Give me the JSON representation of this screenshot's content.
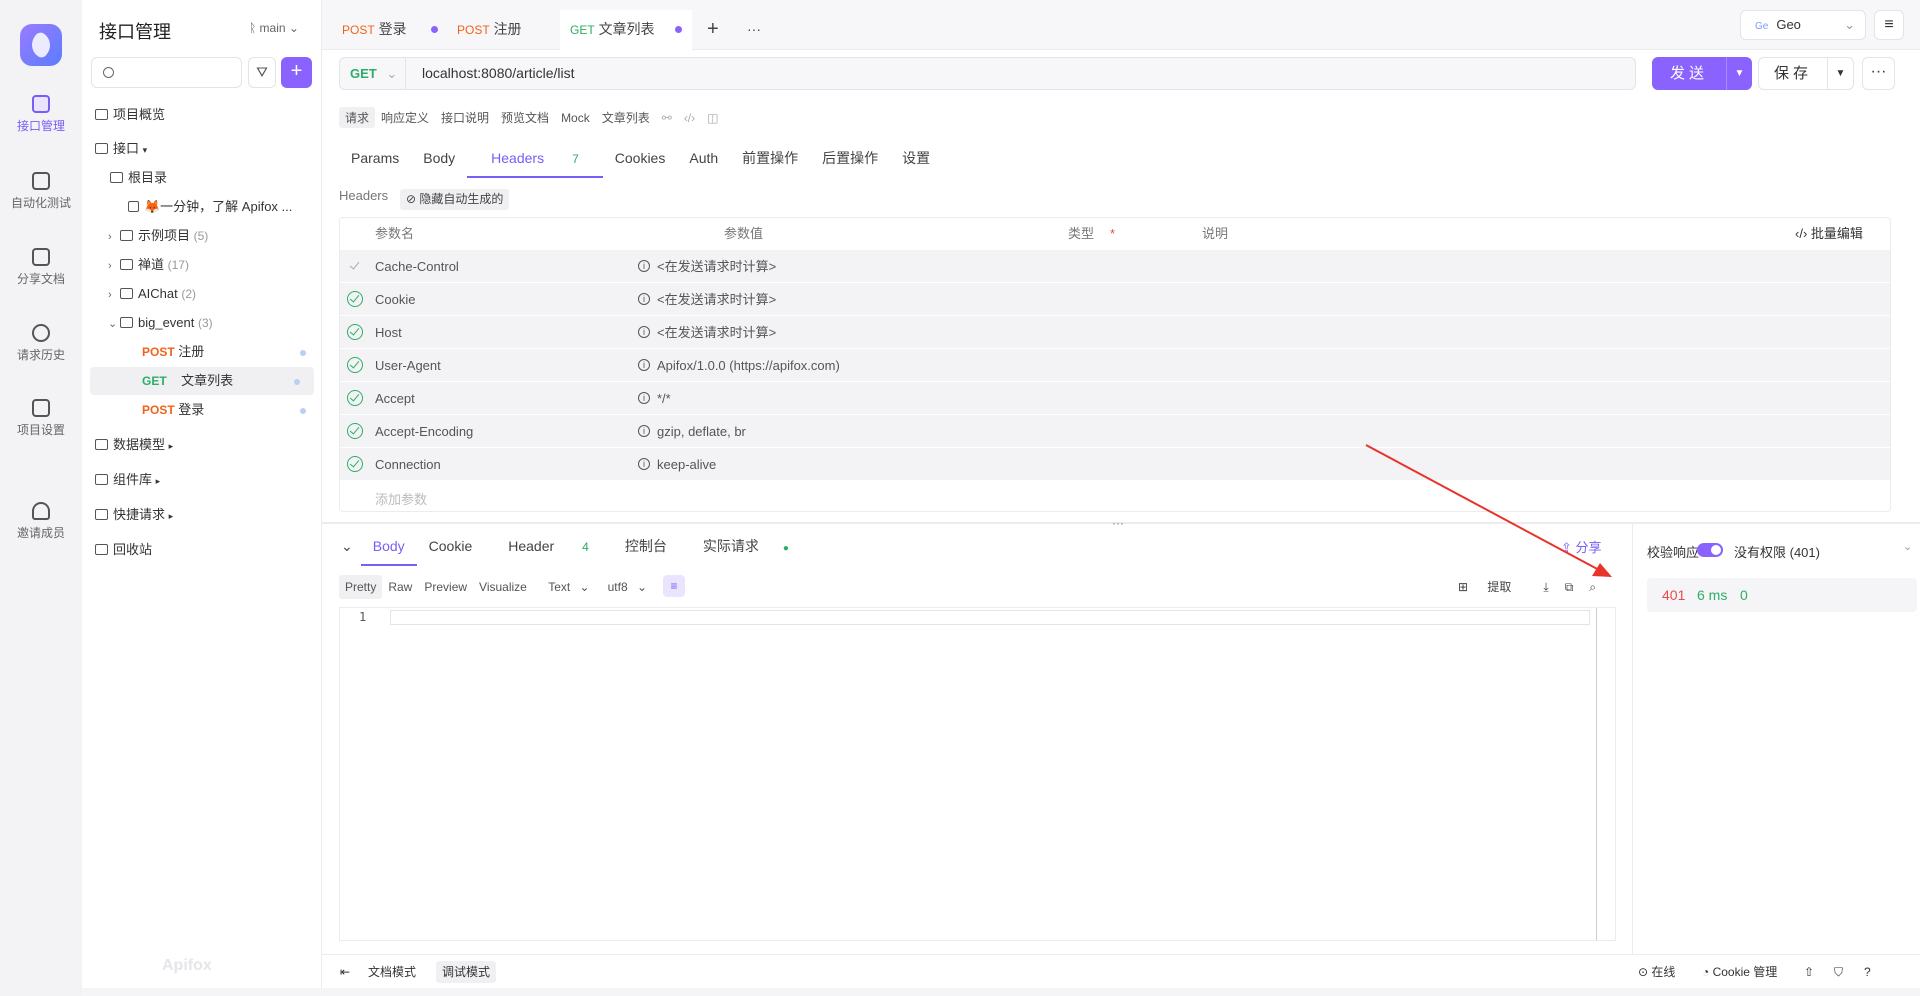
{
  "rail": {
    "items": [
      {
        "label": "接口管理",
        "icon": "api-icon"
      },
      {
        "label": "自动化测试",
        "icon": "automation-icon"
      },
      {
        "label": "分享文档",
        "icon": "share-doc-icon"
      },
      {
        "label": "请求历史",
        "icon": "history-icon"
      },
      {
        "label": "项目设置",
        "icon": "settings-icon"
      },
      {
        "label": "邀请成员",
        "icon": "invite-icon"
      }
    ]
  },
  "sidebar": {
    "title": "接口管理",
    "branch": "main",
    "search_placeholder": "",
    "tree": {
      "overview": "项目概览",
      "api_root": "接口",
      "root_dir": "根目录",
      "intro": "🦊一分钟，了解 Apifox ...",
      "example": {
        "label": "示例项目",
        "count": "(5)"
      },
      "zen": {
        "label": "禅道",
        "count": "(17)"
      },
      "aichat": {
        "label": "AIChat",
        "count": "(2)"
      },
      "big_event": {
        "label": "big_event",
        "count": "(3)"
      },
      "endpoints": [
        {
          "method": "POST",
          "name": "注册"
        },
        {
          "method": "GET",
          "name": "文章列表"
        },
        {
          "method": "POST",
          "name": "登录"
        }
      ],
      "data_model": "数据模型",
      "components": "组件库",
      "quick_request": "快捷请求",
      "recycle": "回收站"
    },
    "watermark": "Apifox"
  },
  "tabs": [
    {
      "method": "POST",
      "name": "登录"
    },
    {
      "method": "POST",
      "name": "注册"
    },
    {
      "method": "GET",
      "name": "文章列表"
    }
  ],
  "env": {
    "badge": "Ge",
    "name": "Geo"
  },
  "request": {
    "method": "GET",
    "url": "localhost:8080/article/list",
    "send": "发送",
    "save": "保存"
  },
  "subtabs": [
    "请求",
    "响应定义",
    "接口说明",
    "预览文档",
    "Mock",
    "文章列表"
  ],
  "req_tabs": [
    {
      "label": "Params"
    },
    {
      "label": "Body"
    },
    {
      "label": "Headers",
      "count": "7"
    },
    {
      "label": "Cookies"
    },
    {
      "label": "Auth"
    },
    {
      "label": "前置操作"
    },
    {
      "label": "后置操作"
    },
    {
      "label": "设置"
    }
  ],
  "headers_section": {
    "label": "Headers",
    "hide_btn": "隐藏自动生成的",
    "col_name": "参数名",
    "col_value": "参数值",
    "col_type": "类型",
    "col_required": "*",
    "col_desc": "说明",
    "bulk_edit": "批量编辑",
    "add_param": "添加参数",
    "rows": [
      {
        "name": "Cache-Control",
        "value": "<在发送请求时计算>"
      },
      {
        "name": "Cookie",
        "value": "<在发送请求时计算>"
      },
      {
        "name": "Host",
        "value": "<在发送请求时计算>"
      },
      {
        "name": "User-Agent",
        "value": "Apifox/1.0.0 (https://apifox.com)"
      },
      {
        "name": "Accept",
        "value": "*/*"
      },
      {
        "name": "Accept-Encoding",
        "value": "gzip, deflate, br"
      },
      {
        "name": "Connection",
        "value": "keep-alive"
      }
    ]
  },
  "response": {
    "tabs": [
      {
        "label": "Body"
      },
      {
        "label": "Cookie"
      },
      {
        "label": "Header",
        "count": "4"
      },
      {
        "label": "控制台"
      },
      {
        "label": "实际请求"
      }
    ],
    "share": "分享",
    "formats": [
      "Pretty",
      "Raw",
      "Preview",
      "Visualize"
    ],
    "type": "Text",
    "encoding": "utf8",
    "extract": "提取",
    "line_no": "1",
    "verify_label": "校验响应",
    "verify_on": true,
    "verify_result": "没有权限 (401)",
    "status": "401",
    "time": "6 ms",
    "size": "0"
  },
  "bottom": {
    "doc_mode": "文档模式",
    "debug_mode": "调试模式",
    "online": "在线",
    "cookie_mgr": "Cookie 管理"
  },
  "colors": {
    "accent": "#8a63ff",
    "get": "#2bae66",
    "post": "#f0631a",
    "error": "#e94b4b",
    "annotation_arrow": "#e8332a"
  }
}
